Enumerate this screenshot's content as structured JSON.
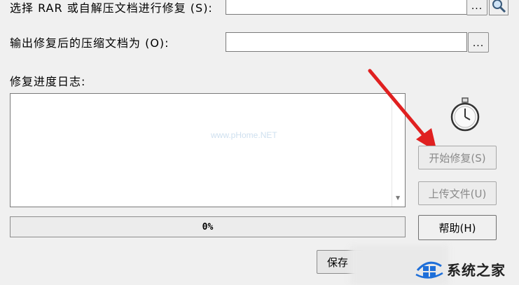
{
  "repair_source": {
    "label": "选择 RAR 或自解压文档进行修复 (S):",
    "value": "",
    "browse_label": "..."
  },
  "output_file": {
    "label": "输出修复后的压缩文档为 (O):",
    "value": "",
    "browse_label": "..."
  },
  "log": {
    "label": "修复进度日志:",
    "content": ""
  },
  "watermark": "www.pHome.NET",
  "buttons": {
    "start_repair": "开始修复(S)",
    "upload_file": "上传文件(U)",
    "help": "帮助(H)",
    "save": "保存"
  },
  "progress": {
    "text": "0%",
    "value": 0
  },
  "site_logo": {
    "text": "系统之家"
  },
  "colors": {
    "arrow": "#e02020",
    "logo_blue": "#1e6fd9"
  },
  "icons": {
    "search": "magnifier-icon",
    "timer": "stopwatch-icon",
    "logo": "windows-logo-icon"
  }
}
